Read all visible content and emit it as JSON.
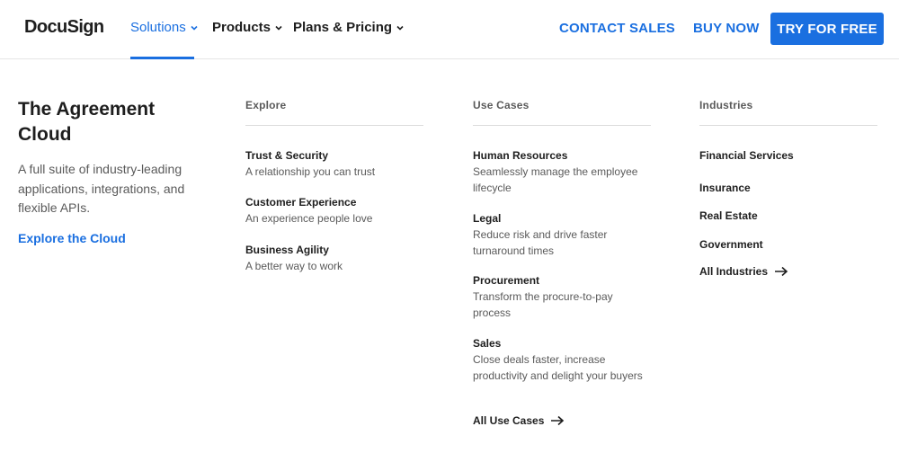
{
  "header": {
    "logo": "DocuSign",
    "nav": [
      {
        "label": "Solutions"
      },
      {
        "label": "Products"
      },
      {
        "label": "Plans & Pricing"
      }
    ],
    "contact_sales": "CONTACT SALES",
    "buy_now": "BUY NOW",
    "try_free": "TRY FOR FREE"
  },
  "intro": {
    "title": "The Agreement Cloud",
    "description": "A full suite of industry-leading applications, integrations, and flexible APIs.",
    "link": "Explore the Cloud"
  },
  "explore": {
    "heading": "Explore",
    "items": [
      {
        "title": "Trust & Security",
        "desc": "A relationship you can trust"
      },
      {
        "title": "Customer Experience",
        "desc": "An experience people love"
      },
      {
        "title": "Business Agility",
        "desc": "A better way to work"
      }
    ]
  },
  "use_cases": {
    "heading": "Use Cases",
    "items": [
      {
        "title": "Human Resources",
        "desc": "Seamlessly manage the employee lifecycle"
      },
      {
        "title": "Legal",
        "desc": "Reduce risk and drive faster turnaround times"
      },
      {
        "title": "Procurement",
        "desc": "Transform the procure-to-pay process"
      },
      {
        "title": "Sales",
        "desc": "Close deals faster, increase productivity and delight your buyers"
      }
    ],
    "all_link": "All Use Cases"
  },
  "industries": {
    "heading": "Industries",
    "items": [
      {
        "title": "Financial Services"
      },
      {
        "title": "Insurance"
      },
      {
        "title": "Real Estate"
      },
      {
        "title": "Government"
      }
    ],
    "all_link": "All Industries"
  },
  "colors": {
    "accent": "#1a6fe0",
    "text": "#1e1e1e",
    "muted": "#5a5a5a"
  }
}
